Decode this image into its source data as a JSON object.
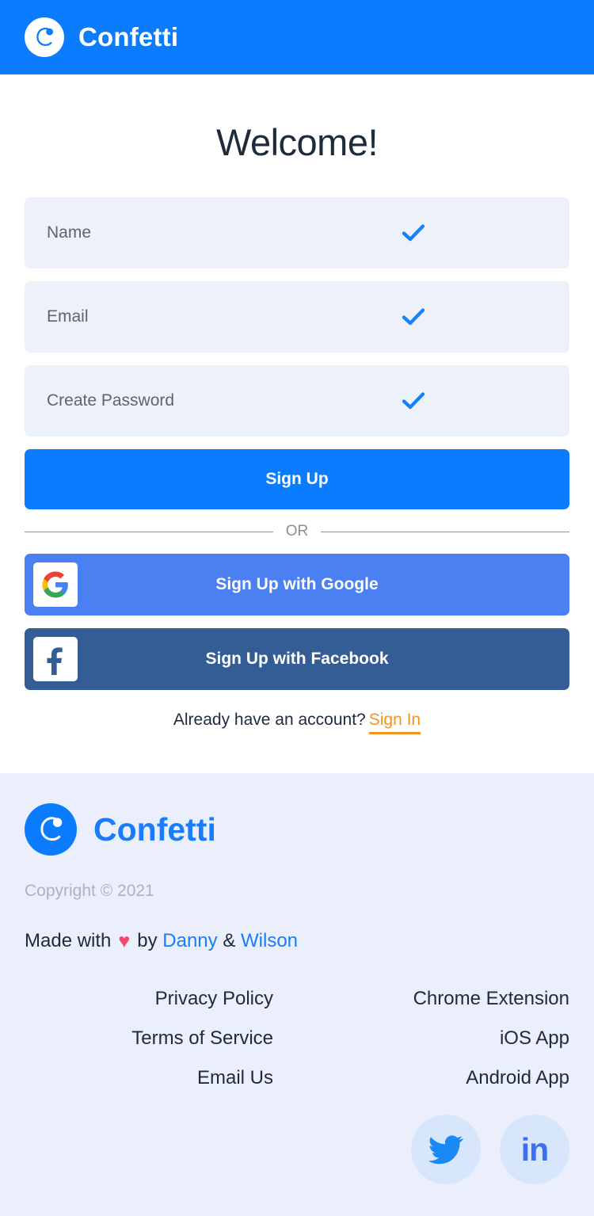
{
  "header": {
    "brand": "Confetti",
    "logo_icon": "confetti-logo-icon",
    "bg_color": "#0b7cfe"
  },
  "main": {
    "heading": "Welcome!",
    "fields": [
      {
        "label": "Name",
        "placeholder": "Name",
        "value": "",
        "valid_icon": "check-icon"
      },
      {
        "label": "Email",
        "placeholder": "Email",
        "value": "",
        "valid_icon": "check-icon"
      },
      {
        "label": "Create Password",
        "placeholder": "Create Password",
        "value": "",
        "valid_icon": "check-icon"
      }
    ],
    "signup_button": "Sign Up",
    "divider_text": "OR",
    "google_button": "Sign Up with Google",
    "facebook_button": "Sign Up with Facebook",
    "account_prompt": "Already have an account?",
    "signin_link": "Sign In"
  },
  "footer": {
    "brand": "Confetti",
    "copyright": "Copyright © 2021",
    "made_with_prefix": "Made with",
    "heart": "♥",
    "made_with_by": "by",
    "author_one": "Danny",
    "author_sep": "&",
    "author_two": "Wilson",
    "links_left": [
      "Privacy Policy",
      "Terms of Service",
      "Email Us"
    ],
    "links_right": [
      "Chrome Extension",
      "iOS App",
      "Android App"
    ],
    "social": [
      {
        "name": "twitter",
        "label": "Twitter"
      },
      {
        "name": "linkedin",
        "label": "in"
      }
    ]
  },
  "colors": {
    "brand_blue": "#0b7cfe",
    "link_blue": "#1a7cfa",
    "google_blue": "#4a80f1",
    "facebook_blue": "#345d96",
    "accent_orange": "#f5941d",
    "heart_pink": "#f5466d",
    "field_bg": "#edf1fa",
    "footer_bg": "#eaeffb",
    "social_circle_bg": "#d8e6fb",
    "text_dark": "#1d2b3c",
    "text_muted": "#aeb2bb"
  }
}
